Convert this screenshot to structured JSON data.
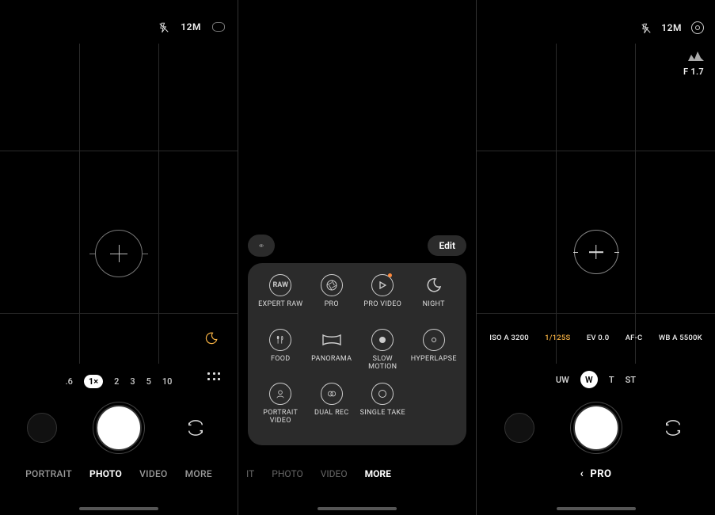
{
  "flash": "off",
  "screen1": {
    "top": {
      "resolution": "12M"
    },
    "zoom": {
      "levels": [
        ".6",
        "1×",
        "2",
        "3",
        "5",
        "10"
      ],
      "active_index": 1
    },
    "modes": {
      "items": [
        "PORTRAIT",
        "PHOTO",
        "VIDEO",
        "MORE"
      ],
      "active_index": 1
    },
    "night_icon_visible": true
  },
  "screen2": {
    "toolbar": {
      "edit_label": "Edit"
    },
    "tiles": [
      {
        "icon": "raw-badge-icon",
        "label": "EXPERT RAW",
        "dot": false
      },
      {
        "icon": "aperture-icon",
        "label": "PRO",
        "dot": false
      },
      {
        "icon": "play-icon",
        "label": "PRO VIDEO",
        "dot": true
      },
      {
        "icon": "moon-icon",
        "label": "NIGHT",
        "dot": false
      },
      {
        "icon": "utensils-icon",
        "label": "FOOD",
        "dot": false
      },
      {
        "icon": "panorama-icon",
        "label": "PANORAMA",
        "dot": false
      },
      {
        "icon": "slowmo-icon",
        "label": "SLOW MOTION",
        "dot": false
      },
      {
        "icon": "hyperlapse-icon",
        "label": "HYPERLAPSE",
        "dot": false
      },
      {
        "icon": "portrait-video-icon",
        "label": "PORTRAIT VIDEO",
        "dot": false
      },
      {
        "icon": "dual-rec-icon",
        "label": "DUAL REC",
        "dot": false
      },
      {
        "icon": "single-take-icon",
        "label": "SINGLE TAKE",
        "dot": false
      }
    ],
    "modes": {
      "items": [
        "IT",
        "PHOTO",
        "VIDEO",
        "MORE"
      ],
      "active_index": 3
    }
  },
  "screen3": {
    "top": {
      "resolution": "12M"
    },
    "f_number": "F 1.7",
    "params": [
      {
        "text": "ISO A 3200",
        "highlight": false
      },
      {
        "text": "1/125S",
        "highlight": true
      },
      {
        "text": "EV 0.0",
        "highlight": false
      },
      {
        "text": "AF-C",
        "highlight": false
      },
      {
        "text": "WB A 5500K",
        "highlight": false
      }
    ],
    "lenses": {
      "items": [
        "UW",
        "W",
        "T",
        "ST"
      ],
      "active_index": 1
    },
    "mode_label": "PRO"
  }
}
